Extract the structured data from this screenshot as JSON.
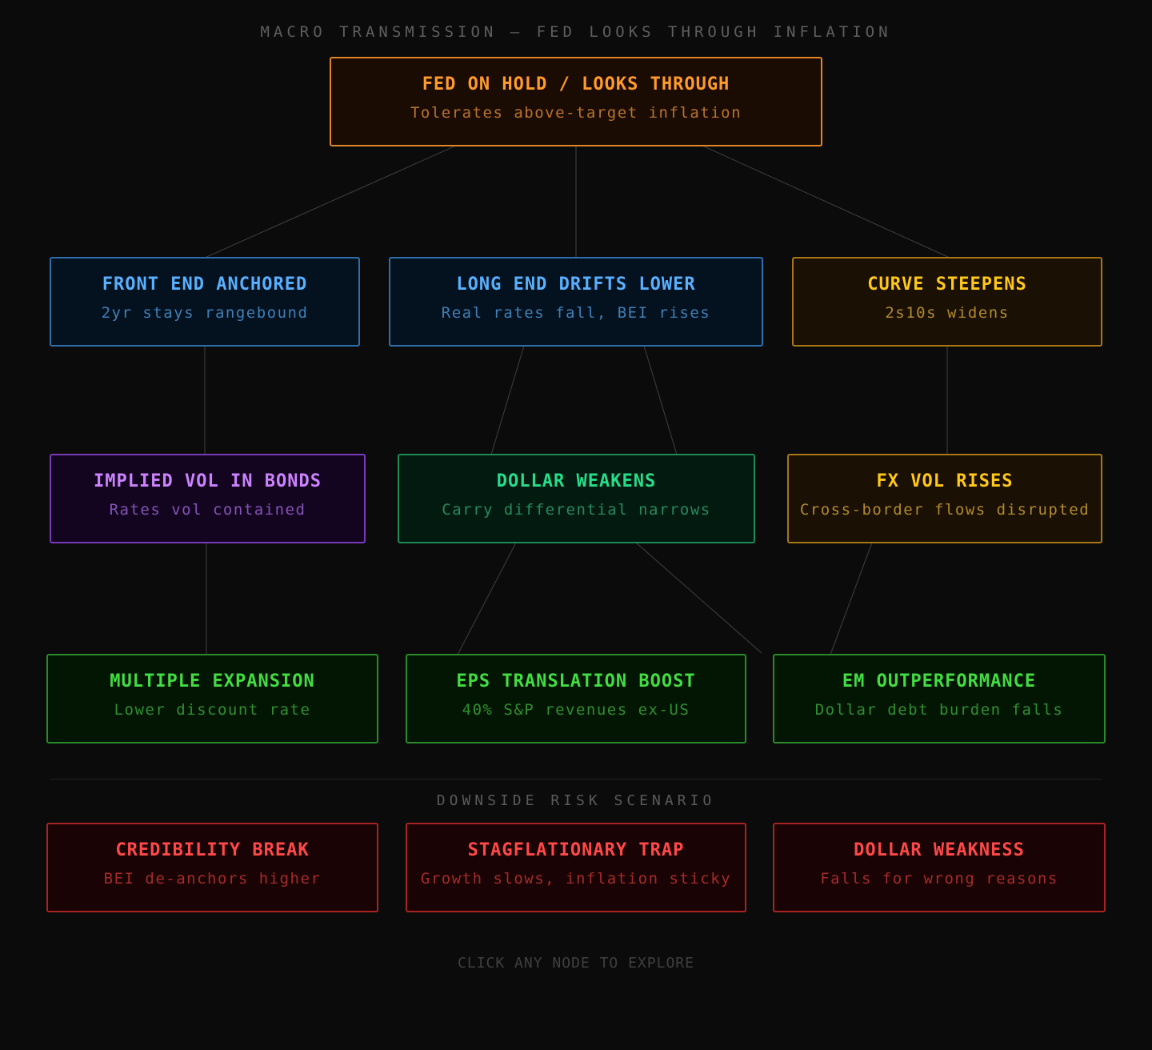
{
  "header": {
    "title": "MACRO TRANSMISSION — FED LOOKS THROUGH INFLATION"
  },
  "nodes": {
    "fed": {
      "title": "FED ON HOLD / LOOKS THROUGH",
      "subtitle": "Tolerates above-target inflation"
    },
    "front_end": {
      "title": "FRONT END ANCHORED",
      "subtitle": "2yr stays rangebound"
    },
    "long_end": {
      "title": "LONG END DRIFTS LOWER",
      "subtitle": "Real rates fall, BEI rises"
    },
    "curve": {
      "title": "CURVE STEEPENS",
      "subtitle": "2s10s widens"
    },
    "implied_vol": {
      "title": "IMPLIED VOL IN BONDS",
      "subtitle": "Rates vol contained"
    },
    "dollar": {
      "title": "DOLLAR WEAKENS",
      "subtitle": "Carry differential narrows"
    },
    "fx_vol": {
      "title": "FX VOL RISES",
      "subtitle": "Cross-border flows disrupted"
    },
    "multiple": {
      "title": "MULTIPLE EXPANSION",
      "subtitle": "Lower discount rate"
    },
    "eps": {
      "title": "EPS TRANSLATION BOOST",
      "subtitle": "40% S&P revenues ex-US"
    },
    "em": {
      "title": "EM OUTPERFORMANCE",
      "subtitle": "Dollar debt burden falls"
    }
  },
  "risk": {
    "section_title": "DOWNSIDE RISK SCENARIO",
    "credibility": {
      "title": "CREDIBILITY BREAK",
      "subtitle": "BEI de-anchors higher"
    },
    "stagflation": {
      "title": "STAGFLATIONARY TRAP",
      "subtitle": "Growth slows, inflation sticky"
    },
    "dollar_weakness": {
      "title": "DOLLAR WEAKNESS",
      "subtitle": "Falls for wrong reasons"
    }
  },
  "footer": {
    "hint": "CLICK ANY NODE TO EXPLORE"
  },
  "colors": {
    "background": "#0b0b0b",
    "connector": "#3a3a3a",
    "orange": "#ff9a2c",
    "blue": "#58b0ff",
    "amber": "#ffc81a",
    "purple": "#cc82ff",
    "teal": "#26dd8a",
    "green": "#43dc43",
    "red": "#ff4848"
  }
}
